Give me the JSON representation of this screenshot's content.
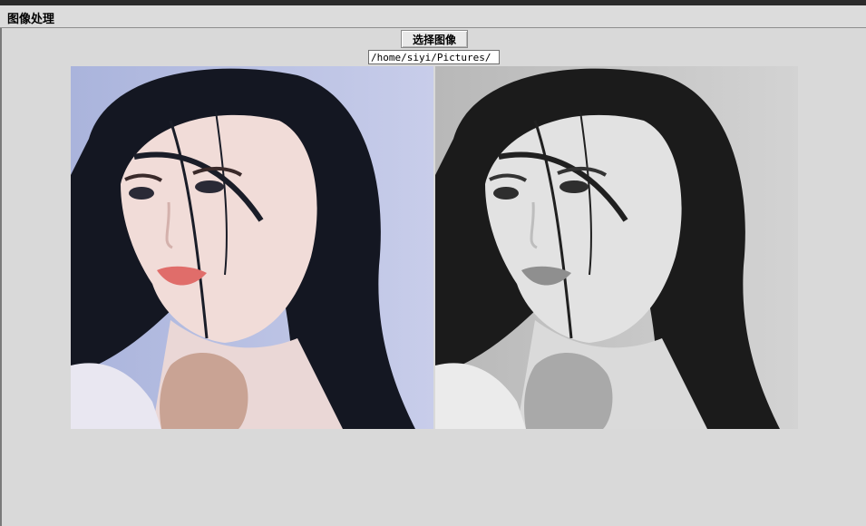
{
  "window": {
    "title": "图像处理"
  },
  "toolbar": {
    "select_image_label": "选择图像"
  },
  "file": {
    "path": "/home/siyi/Pictures/"
  },
  "images": {
    "original": {
      "icon": "photo-original",
      "tint": "#c4cbe7"
    },
    "processed": {
      "icon": "photo-grayscale",
      "tint": "#c9c9c9"
    }
  }
}
